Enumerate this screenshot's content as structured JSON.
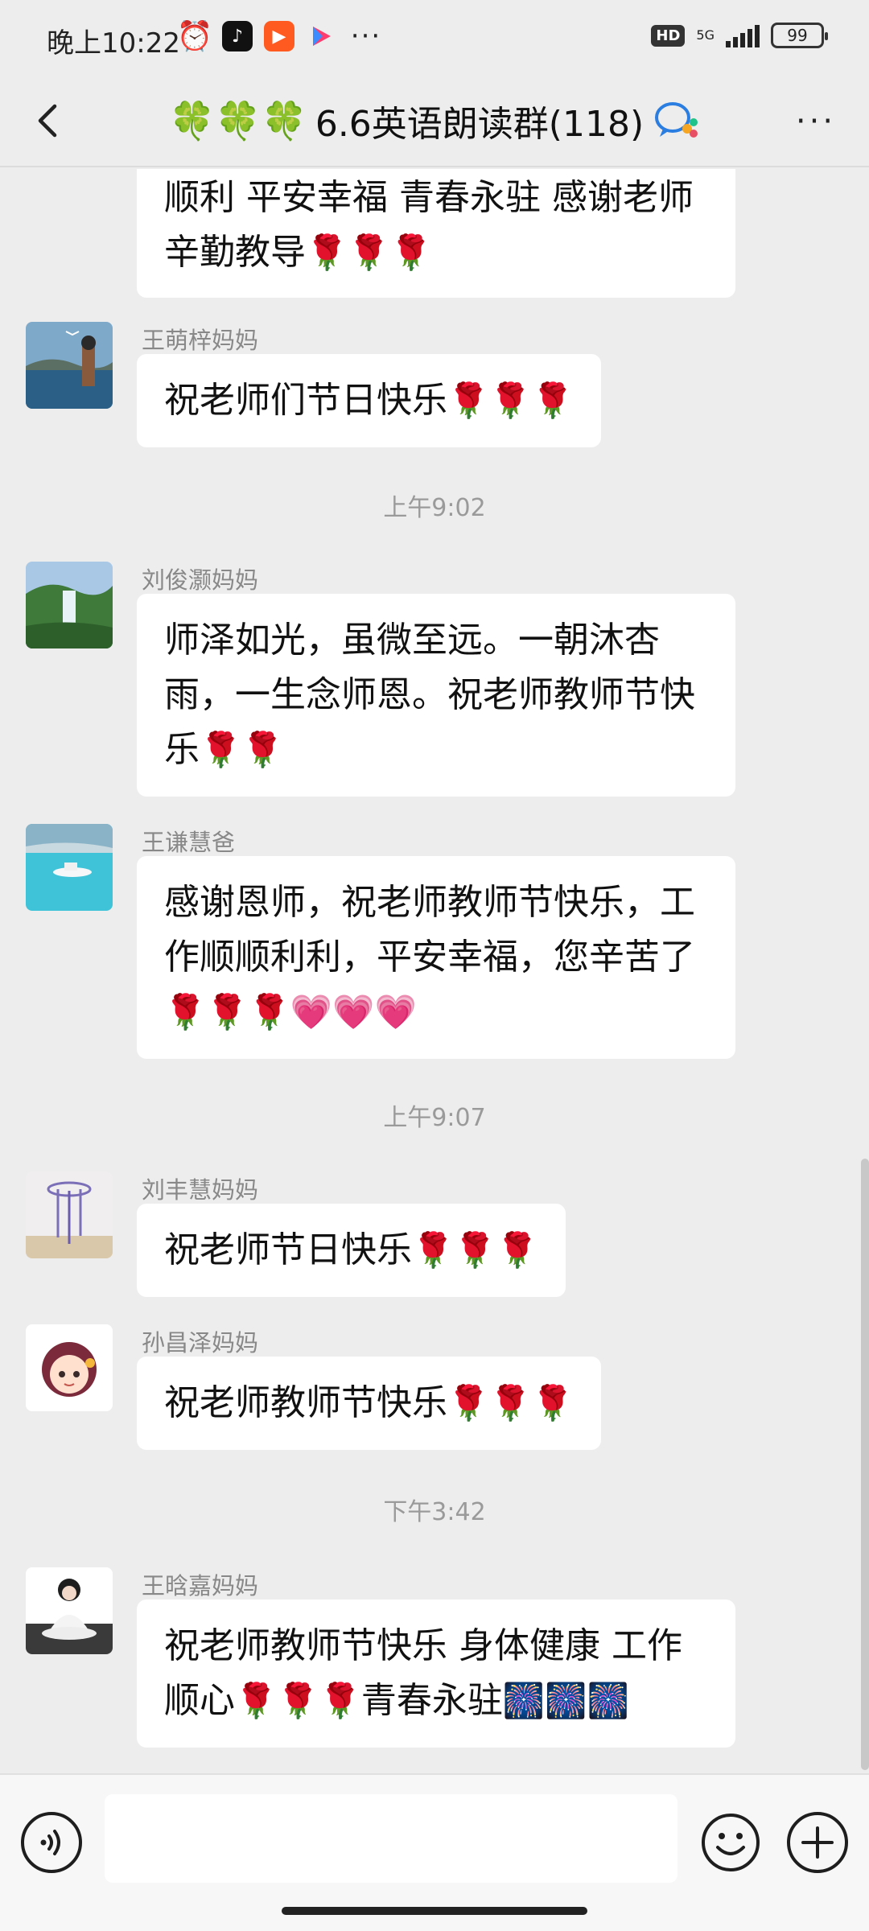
{
  "status_bar": {
    "time": "晚上10:22",
    "network": "5G",
    "battery": "99",
    "hd": "HD",
    "more": "···"
  },
  "header": {
    "clovers": "🍀🍀🍀",
    "title": "6.6英语朗读群(118)",
    "more": "···"
  },
  "messages": [
    {
      "type": "text",
      "sender": "",
      "text": "顺利 平安幸福 青春永驻 感谢老师辛勤教导",
      "emoji": "🌹🌹🌹"
    },
    {
      "type": "text",
      "sender": "王萌梓妈妈",
      "text": "祝老师们节日快乐",
      "emoji": "🌹🌹🌹"
    },
    {
      "type": "time",
      "text": "上午9:02"
    },
    {
      "type": "text",
      "sender": "刘俊灏妈妈",
      "text": "师泽如光，虽微至远。一朝沐杏雨，一生念师恩。祝老师教师节快乐",
      "emoji": "🌹🌹"
    },
    {
      "type": "text",
      "sender": "王谦慧爸",
      "text": "感谢恩师，祝老师教师节快乐，工作顺顺利利，平安幸福，您辛苦了",
      "emoji": "🌹🌹🌹💗💗💗"
    },
    {
      "type": "time",
      "text": "上午9:07"
    },
    {
      "type": "text",
      "sender": "刘丰慧妈妈",
      "text": "祝老师节日快乐",
      "emoji": "🌹🌹🌹"
    },
    {
      "type": "text",
      "sender": "孙昌泽妈妈",
      "text": "祝老师教师节快乐",
      "emoji": "🌹🌹🌹"
    },
    {
      "type": "time",
      "text": "下午3:42"
    },
    {
      "type": "text",
      "sender": "王晗嘉妈妈",
      "text": "祝老师教师节快乐 身体健康 工作顺心",
      "emoji": "🌹🌹🌹",
      "text2": "青春永驻",
      "emoji2": "🎆🎆🎆"
    }
  ],
  "input": {
    "placeholder": ""
  },
  "colors": {
    "background": "#ededed",
    "bubble": "#ffffff",
    "sender": "#888888",
    "timestamp": "#9a9a9a"
  }
}
